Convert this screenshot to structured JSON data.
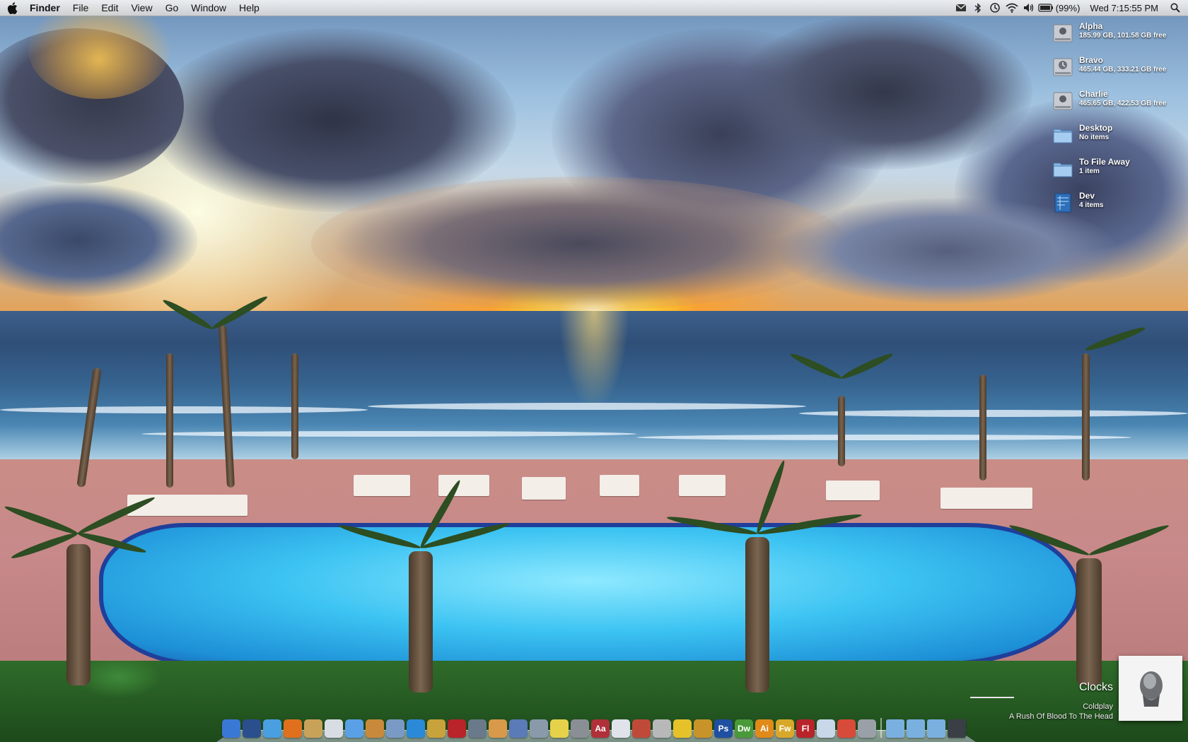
{
  "menubar": {
    "app_name": "Finder",
    "menus": [
      "File",
      "Edit",
      "View",
      "Go",
      "Window",
      "Help"
    ],
    "status_icons": [
      "gmail-notifier-icon",
      "bluetooth-icon",
      "time-machine-icon",
      "wifi-icon",
      "volume-icon",
      "battery-icon"
    ],
    "battery_percent": "(99%)",
    "clock": "Wed 7:15:55 PM"
  },
  "desktop": {
    "items": [
      {
        "name": "Alpha",
        "detail": "185.99 GB, 101.58 GB free",
        "icon": "hard-drive-icon"
      },
      {
        "name": "Bravo",
        "detail": "465.44 GB, 333.21 GB free",
        "icon": "time-machine-drive-icon"
      },
      {
        "name": "Charlie",
        "detail": "465.65 GB, 422.53 GB free",
        "icon": "hard-drive-icon"
      },
      {
        "name": "Desktop",
        "detail": "No items",
        "icon": "folder-icon"
      },
      {
        "name": "To File Away",
        "detail": "1 item",
        "icon": "folder-icon"
      },
      {
        "name": "Dev",
        "detail": "4 items",
        "icon": "blueprint-folder-icon"
      }
    ]
  },
  "dock": {
    "apps": [
      {
        "name": "finder-icon",
        "label": "",
        "color": "#3a78d6"
      },
      {
        "name": "dashboard-icon",
        "label": "",
        "color": "#2b4f8c"
      },
      {
        "name": "safari-icon",
        "label": "",
        "color": "#4a9fe0"
      },
      {
        "name": "firefox-icon",
        "label": "",
        "color": "#e0701e"
      },
      {
        "name": "address-book-icon",
        "label": "",
        "color": "#c9a25a"
      },
      {
        "name": "ical-icon",
        "label": "",
        "color": "#d8dde4"
      },
      {
        "name": "itunes-icon",
        "label": "",
        "color": "#5aa0e6"
      },
      {
        "name": "garageband-icon",
        "label": "",
        "color": "#c88a3a"
      },
      {
        "name": "iphoto-icon",
        "label": "",
        "color": "#7a9ac6"
      },
      {
        "name": "quicktime-icon",
        "label": "",
        "color": "#2a8ad8"
      },
      {
        "name": "pineapple-app-icon",
        "label": "",
        "color": "#c8a23a"
      },
      {
        "name": "photo-booth-icon",
        "label": "",
        "color": "#b8242a"
      },
      {
        "name": "keychain-icon",
        "label": "",
        "color": "#6a7a8a"
      },
      {
        "name": "preview-icon",
        "label": "",
        "color": "#d89a4a"
      },
      {
        "name": "automator-icon",
        "label": "",
        "color": "#5a7ab8"
      },
      {
        "name": "script-editor-icon",
        "label": "",
        "color": "#8a9aaa"
      },
      {
        "name": "stickies-icon",
        "label": "",
        "color": "#e6d24a"
      },
      {
        "name": "calculator-icon",
        "label": "",
        "color": "#8a8f96"
      },
      {
        "name": "dictionary-icon",
        "label": "Aa",
        "color": "#b0303a"
      },
      {
        "name": "textedit-icon",
        "label": "",
        "color": "#e0e4ea"
      },
      {
        "name": "photo-app-icon",
        "label": "",
        "color": "#c04a3a"
      },
      {
        "name": "mail-stamp-icon",
        "label": "",
        "color": "#b8b8b8"
      },
      {
        "name": "cyberduck-icon",
        "label": "",
        "color": "#e6c22a"
      },
      {
        "name": "coda-icon",
        "label": "",
        "color": "#c8942a"
      },
      {
        "name": "photoshop-icon",
        "label": "Ps",
        "color": "#1e4fa0"
      },
      {
        "name": "dreamweaver-icon",
        "label": "Dw",
        "color": "#4a9a3a"
      },
      {
        "name": "illustrator-icon",
        "label": "Ai",
        "color": "#e08a1a"
      },
      {
        "name": "fireworks-icon",
        "label": "Fw",
        "color": "#d8a82a"
      },
      {
        "name": "flash-icon",
        "label": "Fl",
        "color": "#b8242a"
      },
      {
        "name": "transmit-icon",
        "label": "",
        "color": "#c8d8e8"
      },
      {
        "name": "sync-icon",
        "label": "",
        "color": "#d84a3a"
      },
      {
        "name": "system-preferences-icon",
        "label": "",
        "color": "#9aa0a8"
      }
    ],
    "stacks": [
      {
        "name": "documents-stack-icon",
        "color": "#7ab0e0"
      },
      {
        "name": "downloads-stack-icon",
        "color": "#7ab0e0"
      },
      {
        "name": "applications-stack-icon",
        "color": "#7ab0e0"
      },
      {
        "name": "trash-icon",
        "color": "#3a3f46"
      }
    ]
  },
  "now_playing": {
    "title": "Clocks",
    "artist": "Coldplay",
    "album": "A Rush Of Blood To The Head"
  }
}
